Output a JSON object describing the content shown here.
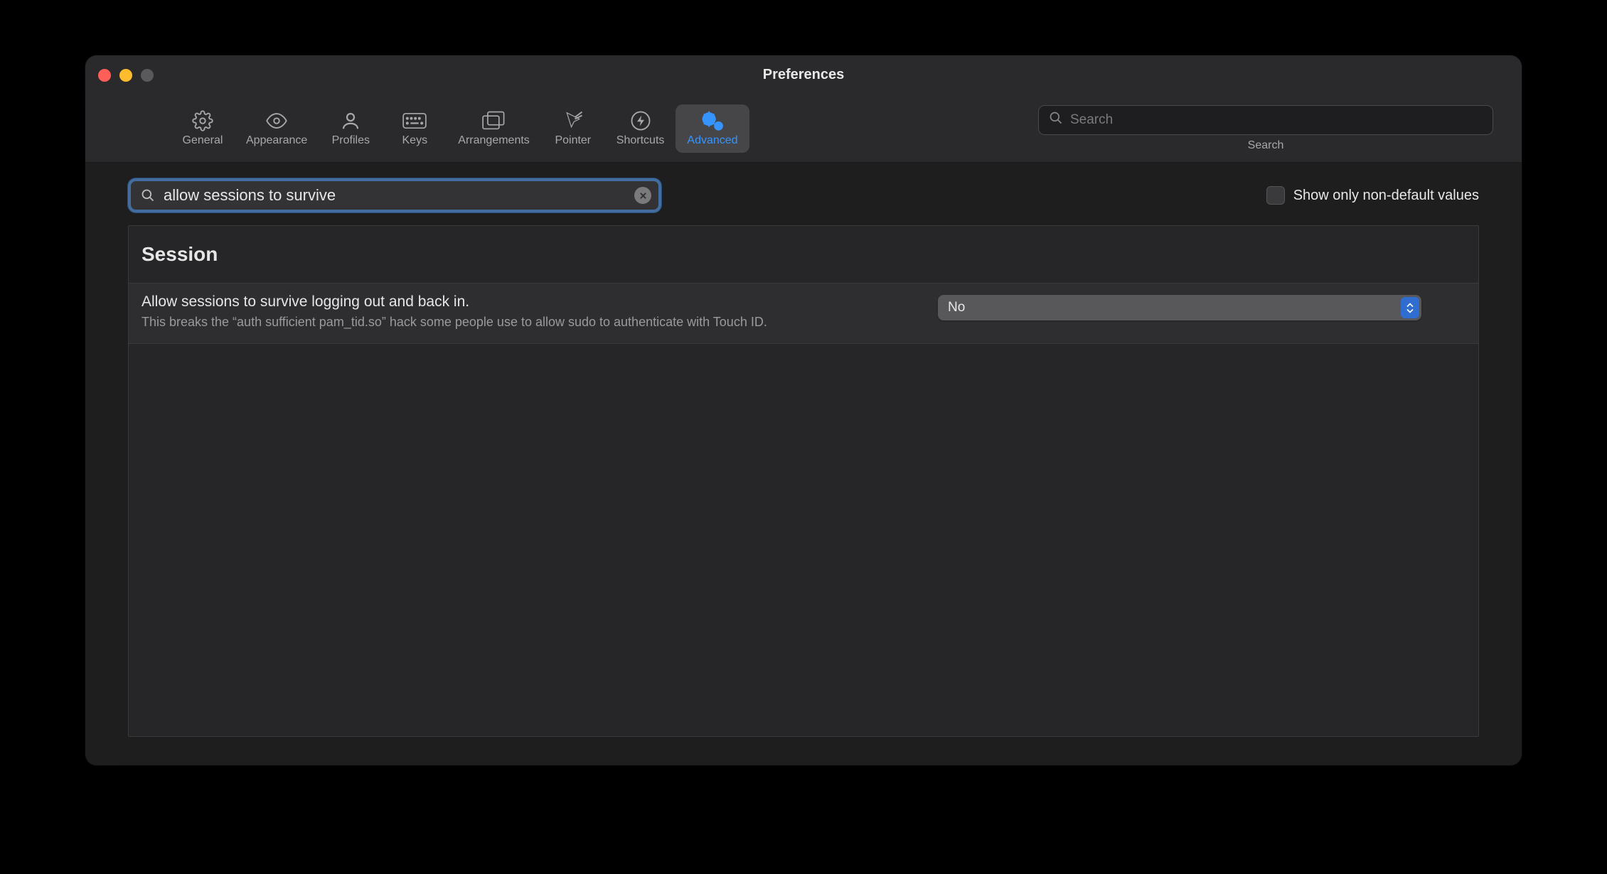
{
  "window": {
    "title": "Preferences"
  },
  "toolbar": {
    "tabs": [
      {
        "id": "general",
        "label": "General"
      },
      {
        "id": "appearance",
        "label": "Appearance"
      },
      {
        "id": "profiles",
        "label": "Profiles"
      },
      {
        "id": "keys",
        "label": "Keys"
      },
      {
        "id": "arrangements",
        "label": "Arrangements"
      },
      {
        "id": "pointer",
        "label": "Pointer"
      },
      {
        "id": "shortcuts",
        "label": "Shortcuts"
      },
      {
        "id": "advanced",
        "label": "Advanced",
        "active": true
      }
    ],
    "search": {
      "placeholder": "Search",
      "label": "Search"
    }
  },
  "filter": {
    "value": "allow sessions to survive",
    "checkbox_label": "Show only non-default values",
    "checkbox_checked": false
  },
  "section": {
    "title": "Session",
    "settings": [
      {
        "title": "Allow sessions to survive logging out and back in.",
        "desc": "This breaks the “auth sufficient pam_tid.so” hack some people use to allow sudo to authenticate with Touch ID.",
        "value": "No"
      }
    ]
  }
}
